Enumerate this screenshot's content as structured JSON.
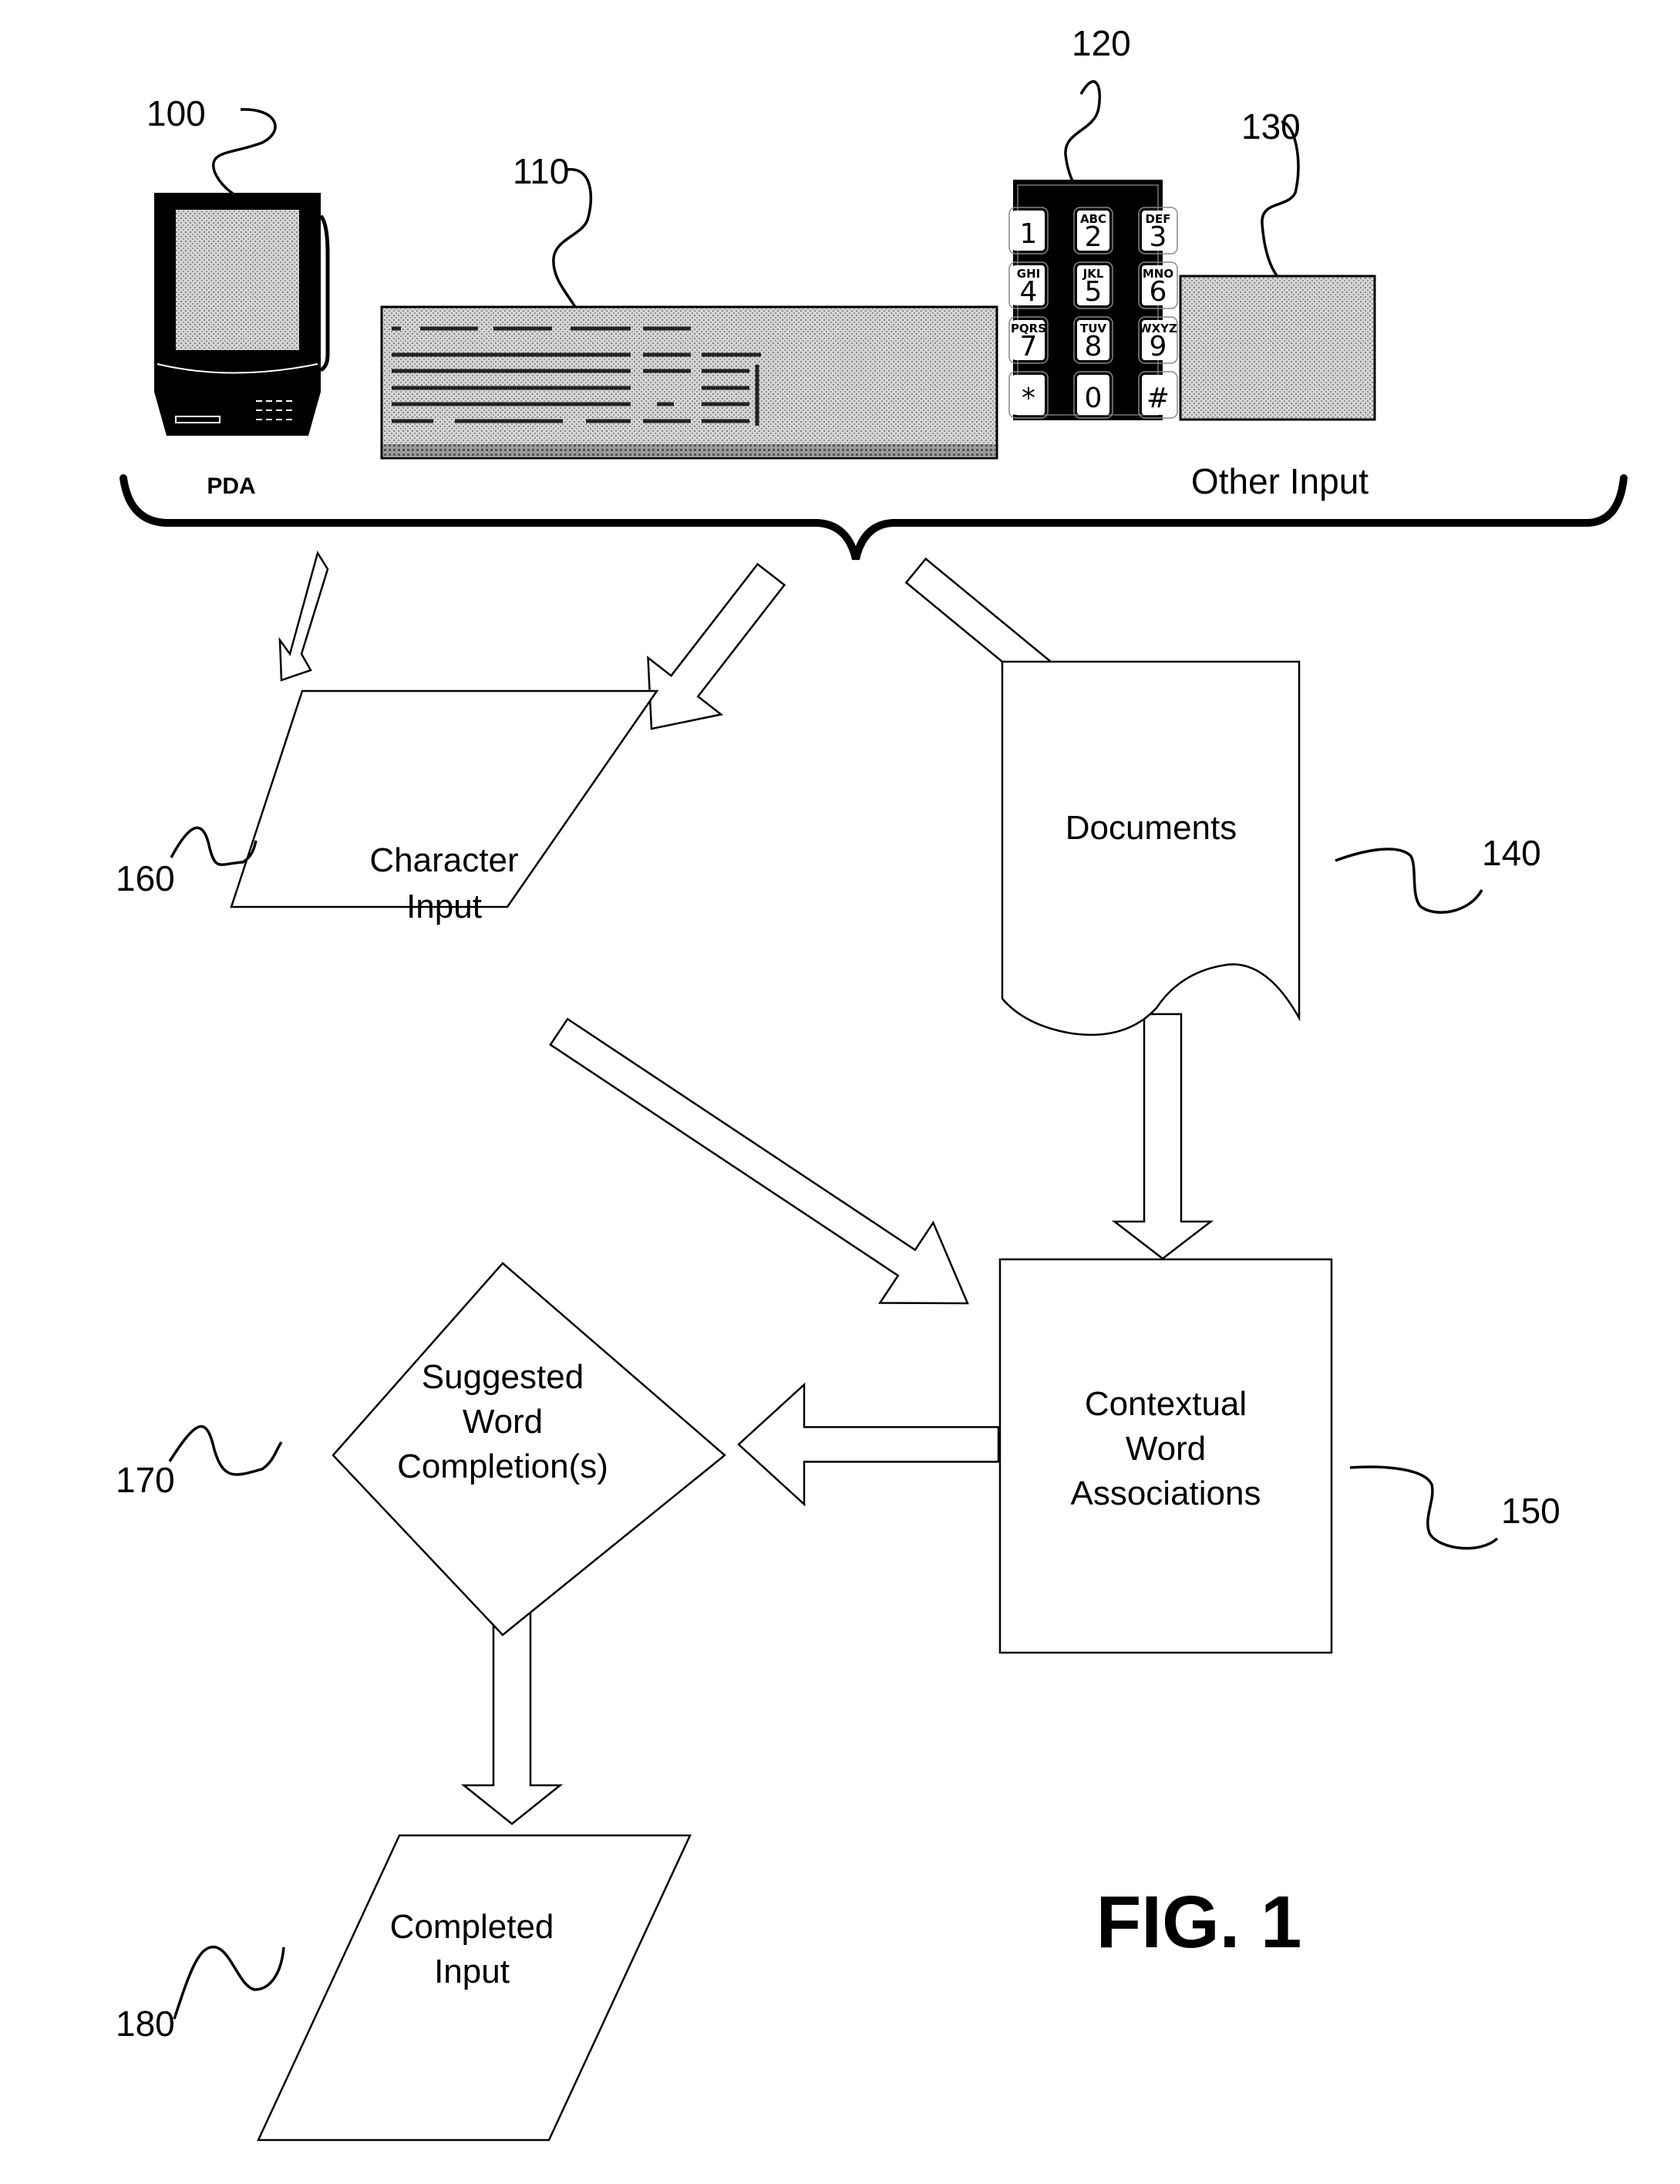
{
  "figure": {
    "title": "FIG. 1"
  },
  "inputs": {
    "pda": {
      "ref": "100",
      "caption": "PDA"
    },
    "keyboard": {
      "ref": "110"
    },
    "keypad": {
      "ref": "120",
      "keys": [
        {
          "num": "1",
          "letters": ""
        },
        {
          "num": "2",
          "letters": "ABC"
        },
        {
          "num": "3",
          "letters": "DEF"
        },
        {
          "num": "4",
          "letters": "GHI"
        },
        {
          "num": "5",
          "letters": "JKL"
        },
        {
          "num": "6",
          "letters": "MNO"
        },
        {
          "num": "7",
          "letters": "PQRS"
        },
        {
          "num": "8",
          "letters": "TUV"
        },
        {
          "num": "9",
          "letters": "WXYZ"
        },
        {
          "num": "*",
          "letters": ""
        },
        {
          "num": "0",
          "letters": ""
        },
        {
          "num": "#",
          "letters": ""
        }
      ]
    },
    "other": {
      "ref": "130",
      "caption": "Other Input"
    }
  },
  "nodes": {
    "documents": {
      "ref": "140",
      "label": "Documents"
    },
    "associations": {
      "ref": "150",
      "lines": [
        "Contextual",
        "Word",
        "Associations"
      ]
    },
    "character_input": {
      "ref": "160",
      "lines": [
        "Character",
        "Input"
      ]
    },
    "suggested": {
      "ref": "170",
      "lines": [
        "Suggested",
        "Word",
        "Completion(s)"
      ]
    },
    "completed": {
      "ref": "180",
      "lines": [
        "Completed",
        "Input"
      ]
    }
  },
  "colors": {
    "ink": "#000000",
    "paper": "#ffffff",
    "screen_gray": "#b8b8b8"
  }
}
